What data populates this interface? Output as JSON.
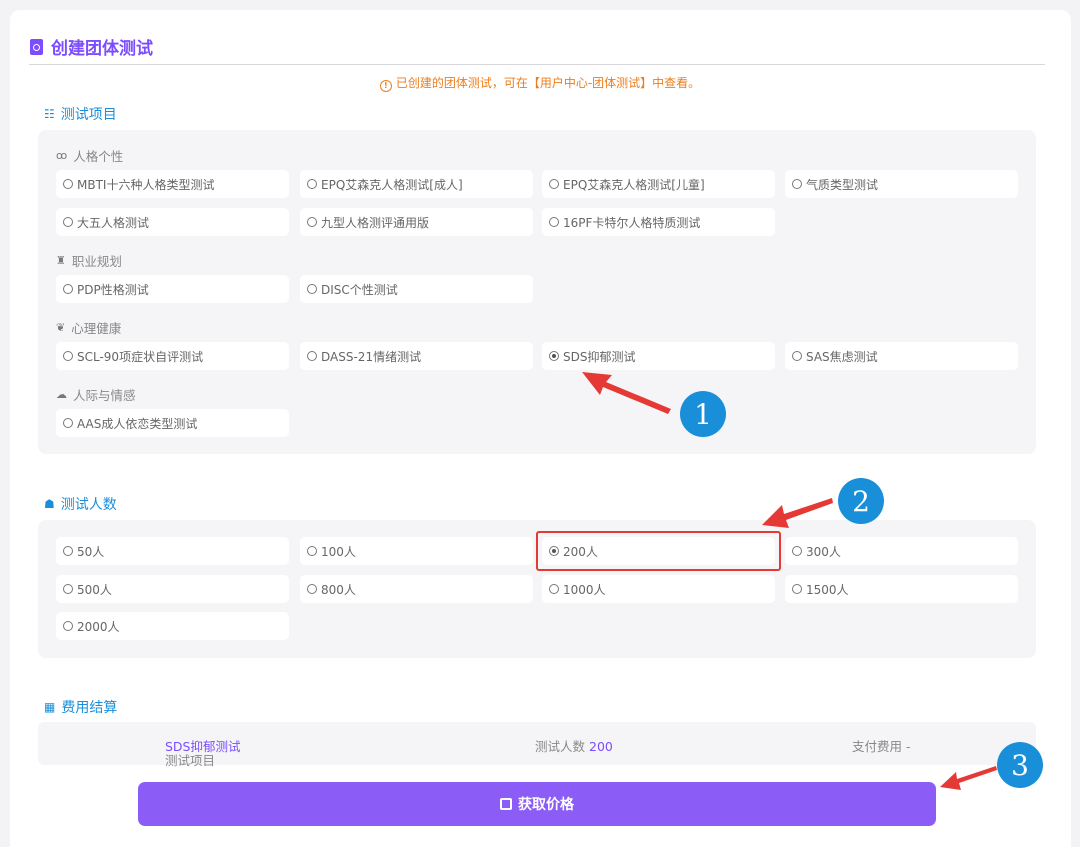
{
  "page_title": "创建团体测试",
  "notice": "已创建的团体测试，可在【用户中心-团体测试】中查看。",
  "notice_icon": "info-circle-icon",
  "sections": {
    "test_items": "测试项目",
    "test_count": "测试人数",
    "fee": "费用结算"
  },
  "groups": [
    {
      "label": "人格个性",
      "icon": "mask-icon",
      "options": [
        "MBTI十六种人格类型测试",
        "EPQ艾森克人格测试[成人]",
        "EPQ艾森克人格测试[儿童]",
        "气质类型测试",
        "大五人格测试",
        "九型人格测评通用版",
        "16PF卡特尔人格特质测试"
      ]
    },
    {
      "label": "职业规划",
      "icon": "tie-icon",
      "options": [
        "PDP性格测试",
        "DISC个性测试"
      ]
    },
    {
      "label": "心理健康",
      "icon": "heart-hand-icon",
      "options": [
        "SCL-90项症状自评测试",
        "DASS-21情绪测试",
        "SDS抑郁测试",
        "SAS焦虑测试"
      ]
    },
    {
      "label": "人际与情感",
      "icon": "handshake-icon",
      "options": [
        "AAS成人依恋类型测试"
      ]
    }
  ],
  "selected_test": "SDS抑郁测试",
  "counts": [
    "50人",
    "100人",
    "200人",
    "300人",
    "500人",
    "800人",
    "1000人",
    "1500人",
    "2000人"
  ],
  "selected_count": "200人",
  "summary": {
    "item_label": "测试项目",
    "item_value": "SDS抑郁测试",
    "count_label": "测试人数",
    "count_value": "200",
    "fee_label": "支付费用",
    "fee_value": "-"
  },
  "submit_label": "获取价格",
  "annotations": [
    "1",
    "2",
    "3"
  ],
  "colors": {
    "accent": "#7c4dff",
    "button": "#8c5cf6",
    "section": "#1a8fd9",
    "notice": "#ee7d1a",
    "annotation_arrow": "#e53935"
  }
}
